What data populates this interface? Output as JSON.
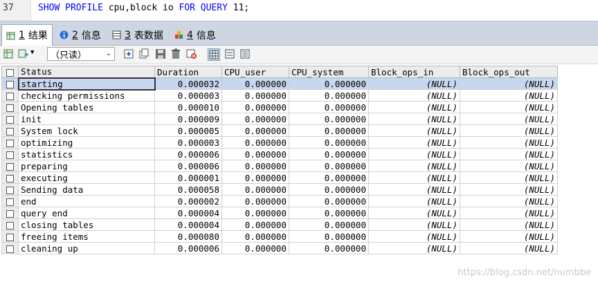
{
  "editor": {
    "line_number": "37",
    "code": [
      {
        "text": "SHOW PROFILE",
        "kw": true
      },
      {
        "text": " cpu,block io ",
        "kw": false
      },
      {
        "text": "FOR QUERY",
        "kw": true
      },
      {
        "text": " 11;",
        "kw": false
      }
    ]
  },
  "tabs": [
    {
      "num": "1",
      "label": "结果",
      "icon": "table-result-icon"
    },
    {
      "num": "2",
      "label": "信息",
      "icon": "info-icon"
    },
    {
      "num": "3",
      "label": "表数据",
      "icon": "table-data-icon"
    },
    {
      "num": "4",
      "label": "信息",
      "icon": "info-colored-icon"
    }
  ],
  "toolbar": {
    "mode_select": "（只读）"
  },
  "grid": {
    "columns": [
      "Status",
      "Duration",
      "CPU_user",
      "CPU_system",
      "Block_ops_in",
      "Block_ops_out"
    ],
    "rows": [
      [
        "starting",
        "0.000032",
        "0.000000",
        "0.000000",
        "(NULL)",
        "(NULL)"
      ],
      [
        "checking permissions",
        "0.000003",
        "0.000000",
        "0.000000",
        "(NULL)",
        "(NULL)"
      ],
      [
        "Opening tables",
        "0.000010",
        "0.000000",
        "0.000000",
        "(NULL)",
        "(NULL)"
      ],
      [
        "init",
        "0.000009",
        "0.000000",
        "0.000000",
        "(NULL)",
        "(NULL)"
      ],
      [
        "System lock",
        "0.000005",
        "0.000000",
        "0.000000",
        "(NULL)",
        "(NULL)"
      ],
      [
        "optimizing",
        "0.000003",
        "0.000000",
        "0.000000",
        "(NULL)",
        "(NULL)"
      ],
      [
        "statistics",
        "0.000006",
        "0.000000",
        "0.000000",
        "(NULL)",
        "(NULL)"
      ],
      [
        "preparing",
        "0.000006",
        "0.000000",
        "0.000000",
        "(NULL)",
        "(NULL)"
      ],
      [
        "executing",
        "0.000001",
        "0.000000",
        "0.000000",
        "(NULL)",
        "(NULL)"
      ],
      [
        "Sending data",
        "0.000058",
        "0.000000",
        "0.000000",
        "(NULL)",
        "(NULL)"
      ],
      [
        "end",
        "0.000002",
        "0.000000",
        "0.000000",
        "(NULL)",
        "(NULL)"
      ],
      [
        "query end",
        "0.000004",
        "0.000000",
        "0.000000",
        "(NULL)",
        "(NULL)"
      ],
      [
        "closing tables",
        "0.000004",
        "0.000000",
        "0.000000",
        "(NULL)",
        "(NULL)"
      ],
      [
        "freeing items",
        "0.000080",
        "0.000000",
        "0.000000",
        "(NULL)",
        "(NULL)"
      ],
      [
        "cleaning up",
        "0.000006",
        "0.000000",
        "0.000000",
        "(NULL)",
        "(NULL)"
      ]
    ]
  },
  "watermark": "https://blog.csdn.net/numbbe"
}
